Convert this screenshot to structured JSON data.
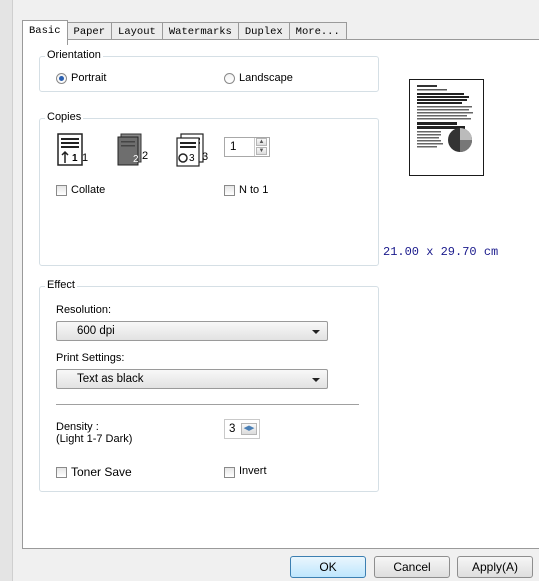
{
  "tabs": [
    "Basic",
    "Paper",
    "Layout",
    "Watermarks",
    "Duplex",
    "More..."
  ],
  "orientation": {
    "label": "Orientation",
    "portrait_label": "Portrait",
    "landscape_label": "Landscape",
    "selected": "Portrait"
  },
  "copies": {
    "label": "Copies",
    "count": "1",
    "collate_label": "Collate",
    "collate_checked": false,
    "n_to_1_label": "N to 1",
    "n_to_1_checked": false,
    "icon_numbers": {
      "single": [
        "1",
        "1"
      ],
      "multi": [
        "2",
        "2"
      ],
      "collate": [
        "3",
        "3"
      ]
    }
  },
  "preview": {
    "size_text": "21.00 x 29.70 cm"
  },
  "effect": {
    "label": "Effect",
    "resolution_label": "Resolution:",
    "resolution_value": "600 dpi",
    "print_settings_label": "Print Settings:",
    "print_settings_value": "Text as black",
    "density_label_line1": "Density :",
    "density_label_line2": "(Light 1-7 Dark)",
    "density_value": "3",
    "toner_save_label": "Toner Save",
    "toner_save_checked": false,
    "invert_label": "Invert",
    "invert_checked": false
  },
  "buttons": {
    "ok": "OK",
    "cancel": "Cancel",
    "apply": "Apply(A)"
  },
  "colors": {
    "accent_text": "#1a1a8c",
    "default_button_border": "#3c7fb1",
    "group_border": "#d5dfe5"
  }
}
